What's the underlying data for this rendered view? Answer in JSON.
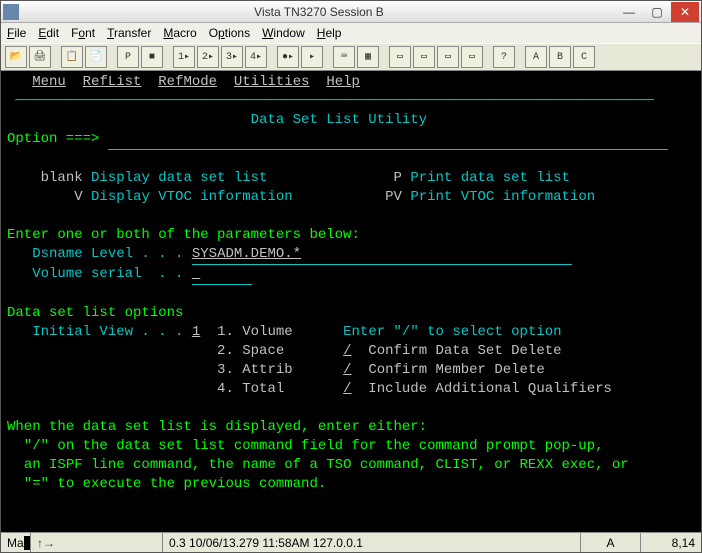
{
  "titlebar": {
    "title": "Vista TN3270 Session B"
  },
  "menubar": {
    "file": "File",
    "edit": "Edit",
    "font": "Font",
    "transfer": "Transfer",
    "macro": "Macro",
    "options": "Options",
    "window": "Window",
    "help": "Help"
  },
  "ispf_menu": {
    "menu": "Menu",
    "reflist": "RefList",
    "refmode": "RefMode",
    "utilities": "Utilities",
    "help": "Help"
  },
  "panel_title": "Data Set List Utility",
  "option_prompt": "Option ===>",
  "opts": {
    "blank_key": "blank",
    "blank_desc": "Display data set list",
    "p_key": "P",
    "p_desc": "Print data set list",
    "v_key": "V",
    "v_desc": "Display VTOC information",
    "pv_key": "PV",
    "pv_desc": "Print VTOC information"
  },
  "params_hdr": "Enter one or both of the parameters below:",
  "dsname_label": "Dsname Level . . .",
  "dsname_value": "SYSADM.DEMO.*",
  "volser_label": "Volume serial  . .",
  "list_hdr": "Data set list options",
  "initview_label": "Initial View . . .",
  "initview_value": "1",
  "views": {
    "v1": "1. Volume",
    "v2": "2. Space",
    "v3": "3. Attrib",
    "v4": "4. Total"
  },
  "select_hdr": "Enter \"/\" to select option",
  "sel": {
    "s1": "Confirm Data Set Delete",
    "s2": "Confirm Member Delete",
    "s3": "Include Additional Qualifiers",
    "slash": "/"
  },
  "help_hdr": "When the data set list is displayed, enter either:",
  "help1": "\"/\" on the data set list command field for the command prompt pop-up,",
  "help2": "an ISPF line command, the name of a TSO command, CLIST, or REXX exec, or",
  "help3": "\"=\" to execute the previous command.",
  "statusbar": {
    "s1": "Ma",
    "s2": "",
    "s3": "0.3 10/06/13.279 11:58AM 127.0.0.1",
    "s4": "A",
    "s5": "8,14"
  },
  "tool_labels": {
    "a": "A",
    "b": "B",
    "c": "C"
  }
}
